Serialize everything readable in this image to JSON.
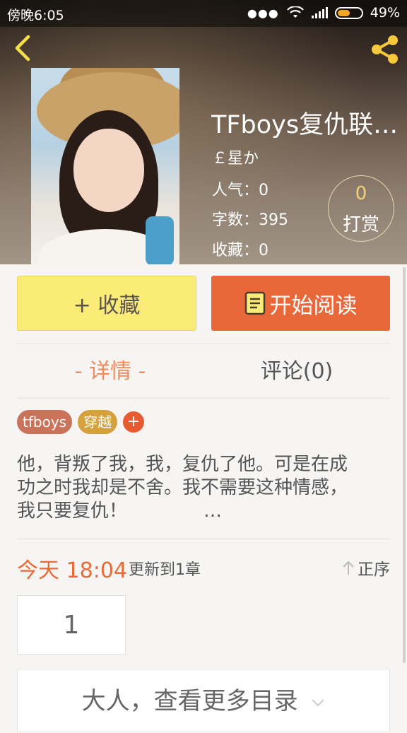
{
  "status_bar": {
    "time": "傍晚6:05",
    "battery_percent": "49%",
    "battery_level": 0.49
  },
  "book": {
    "title": "TFboys复仇联…",
    "author": "￡星か",
    "popularity": "人气：0",
    "word_count": "字数：395",
    "favorites": "收藏：0"
  },
  "reward": {
    "count": "0",
    "label": "打赏"
  },
  "actions": {
    "favorite_label": "+ 收藏",
    "read_label": "开始阅读"
  },
  "tabs": [
    {
      "label": "- 详情 -",
      "active": true
    },
    {
      "label": "评论(0)",
      "active": false
    }
  ],
  "tags": [
    {
      "label": "tfboys",
      "color": "#c8735a"
    },
    {
      "label": "穿越",
      "color": "#d4a13c"
    }
  ],
  "tag_add_label": "+",
  "synopsis": {
    "line1": "他，背叛了我，我，复仇了他。可是在成",
    "line2": "功之时我却是不舍。我不需要这种情感，",
    "line3": "我只要复仇！",
    "ellipsis": "…"
  },
  "update": {
    "time": "今天 18:04",
    "text": "更新到1章",
    "sort_label": "正序"
  },
  "chapters": [
    "1"
  ],
  "more_catalog_label": "大人，查看更多目录",
  "colors": {
    "accent": "#e9683a",
    "favorite_bg": "#fbeb77",
    "tab_active": "#ef8a5c"
  }
}
